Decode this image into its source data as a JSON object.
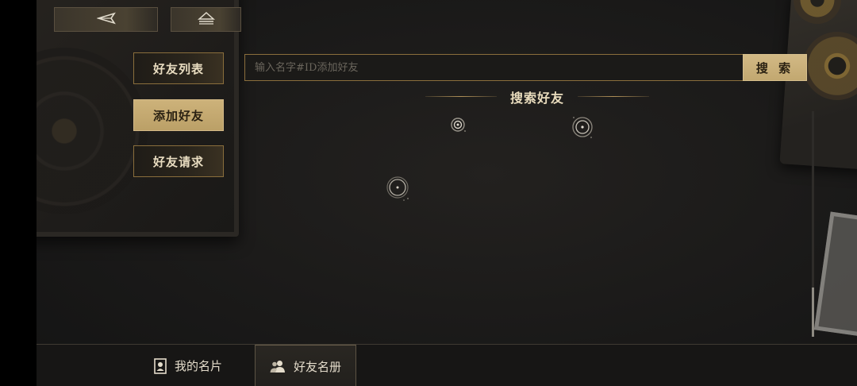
{
  "top_nav": {
    "back_icon": "back-arrow-icon",
    "home_icon": "eject-home-icon"
  },
  "side_tabs": [
    {
      "label": "好友列表",
      "active": false
    },
    {
      "label": "添加好友",
      "active": true
    },
    {
      "label": "好友请求",
      "active": false
    }
  ],
  "search": {
    "placeholder": "输入名字#ID添加好友",
    "value": "",
    "button_label": "搜 索"
  },
  "section": {
    "title": "搜索好友"
  },
  "bottom_nav": {
    "tabs": [
      {
        "label": "我的名片",
        "icon": "id-card-icon",
        "active": false
      },
      {
        "label": "好友名册",
        "icon": "users-icon",
        "active": true
      }
    ]
  },
  "colors": {
    "accent_gold": "#c9ae78",
    "border_gold": "#8a6e3c",
    "background": "#1c1b1a"
  }
}
